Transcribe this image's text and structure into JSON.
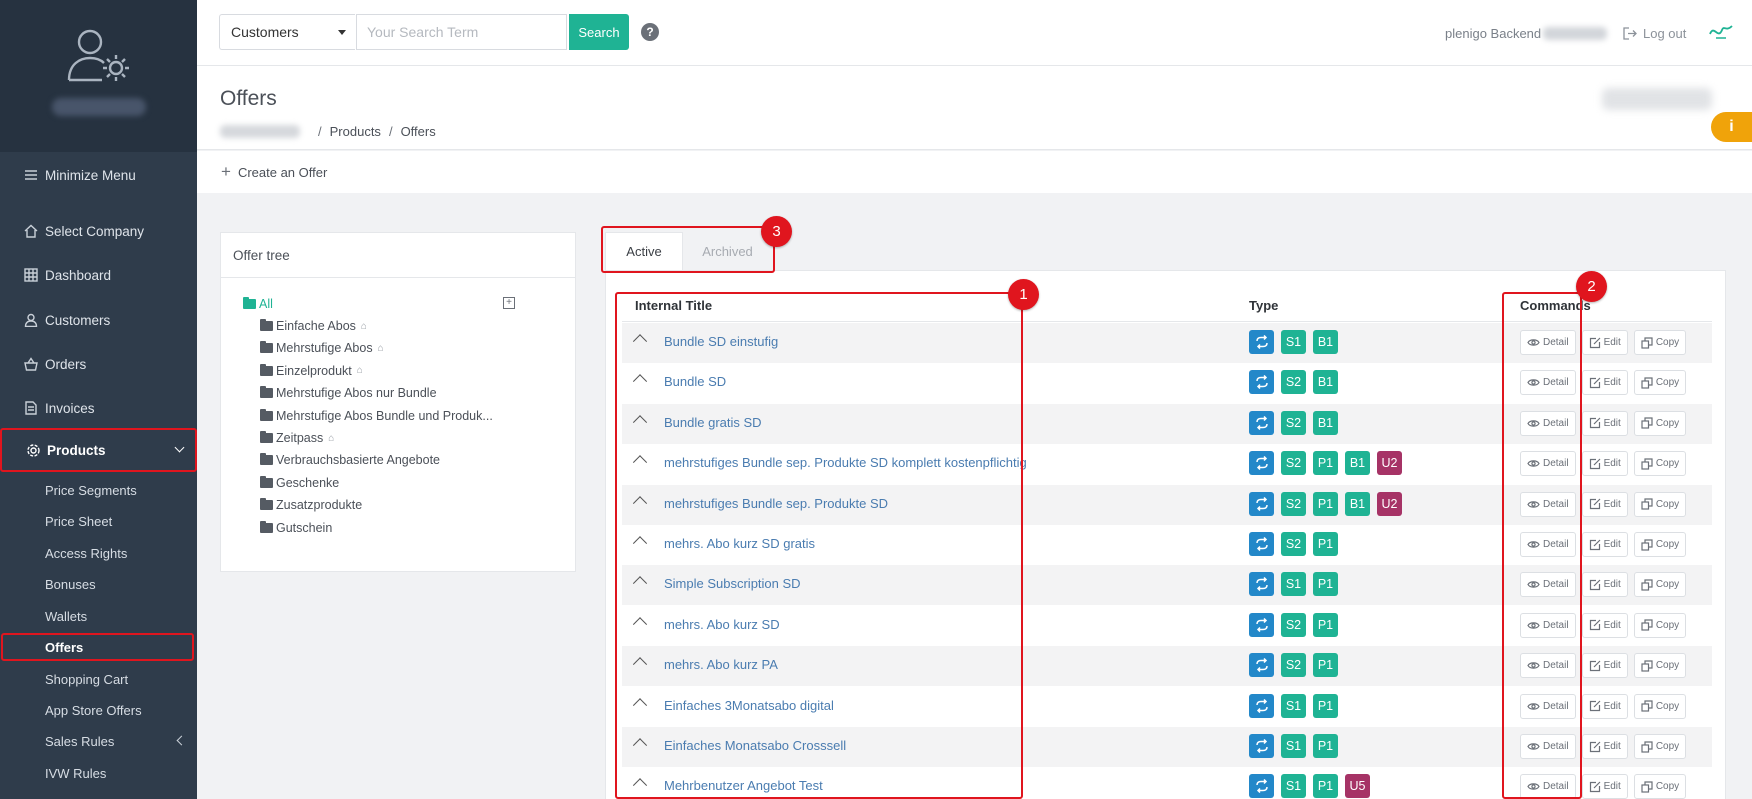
{
  "sidebar": {
    "minimize": "Minimize Menu",
    "items": [
      {
        "label": "Select Company",
        "icon": "home-icon"
      },
      {
        "label": "Dashboard",
        "icon": "grid-icon"
      },
      {
        "label": "Customers",
        "icon": "user-icon"
      },
      {
        "label": "Orders",
        "icon": "basket-icon"
      },
      {
        "label": "Invoices",
        "icon": "document-icon"
      },
      {
        "label": "Products",
        "icon": "gear-icon"
      }
    ],
    "products_sub": [
      "Price Segments",
      "Price Sheet",
      "Access Rights",
      "Bonuses",
      "Wallets",
      "Offers",
      "Shopping Cart",
      "App Store Offers",
      "Sales Rules",
      "IVW Rules"
    ]
  },
  "topbar": {
    "search_category": "Customers",
    "search_placeholder": "Your Search Term",
    "search_button": "Search",
    "help": "?",
    "user_label": "plenigo Backend",
    "logout": "Log out"
  },
  "page": {
    "title": "Offers",
    "breadcrumb": [
      "Products",
      "Offers"
    ],
    "info": "i",
    "create": "Create an Offer"
  },
  "tree": {
    "title": "Offer tree",
    "add": "+",
    "root": "All",
    "nodes": [
      {
        "label": "Einfache Abos",
        "mark": true
      },
      {
        "label": "Mehrstufige Abos",
        "mark": true
      },
      {
        "label": "Einzelprodukt",
        "mark": true
      },
      {
        "label": "Mehrstufige Abos nur Bundle",
        "mark": false
      },
      {
        "label": "Mehrstufige Abos Bundle und Produk...",
        "mark": false
      },
      {
        "label": "Zeitpass",
        "mark": true
      },
      {
        "label": "Verbrauchsbasierte Angebote",
        "mark": false
      },
      {
        "label": "Geschenke",
        "mark": false
      },
      {
        "label": "Zusatzprodukte",
        "mark": false
      },
      {
        "label": "Gutschein",
        "mark": false
      }
    ]
  },
  "tabs": {
    "active": "Active",
    "archived": "Archived"
  },
  "callouts": [
    "1",
    "2",
    "3"
  ],
  "table": {
    "headers": {
      "title": "Internal Title",
      "type": "Type",
      "commands": "Commands"
    },
    "commands": {
      "detail": "Detail",
      "edit": "Edit",
      "copy": "Copy"
    },
    "rows": [
      {
        "title": "Bundle SD einstufig",
        "tags": [
          "S1",
          "B1"
        ]
      },
      {
        "title": "Bundle SD",
        "tags": [
          "S2",
          "B1"
        ]
      },
      {
        "title": "Bundle gratis SD",
        "tags": [
          "S2",
          "B1"
        ]
      },
      {
        "title": "mehrstufiges Bundle sep. Produkte SD komplett kostenpflichtig",
        "tags": [
          "S2",
          "P1",
          "B1",
          "U2"
        ]
      },
      {
        "title": "mehrstufiges Bundle sep. Produkte SD",
        "tags": [
          "S2",
          "P1",
          "B1",
          "U2"
        ]
      },
      {
        "title": "mehrs. Abo kurz SD gratis",
        "tags": [
          "S2",
          "P1"
        ]
      },
      {
        "title": "Simple Subscription SD",
        "tags": [
          "S1",
          "P1"
        ]
      },
      {
        "title": "mehrs. Abo kurz SD",
        "tags": [
          "S2",
          "P1"
        ]
      },
      {
        "title": "mehrs. Abo kurz PA",
        "tags": [
          "S2",
          "P1"
        ]
      },
      {
        "title": "Einfaches 3Monatsabo digital",
        "tags": [
          "S1",
          "P1"
        ]
      },
      {
        "title": "Einfaches Monatsabo Crosssell",
        "tags": [
          "S1",
          "P1"
        ]
      },
      {
        "title": "Mehrbenutzer Angebot Test",
        "tags": [
          "S1",
          "P1",
          "U5"
        ]
      }
    ]
  }
}
